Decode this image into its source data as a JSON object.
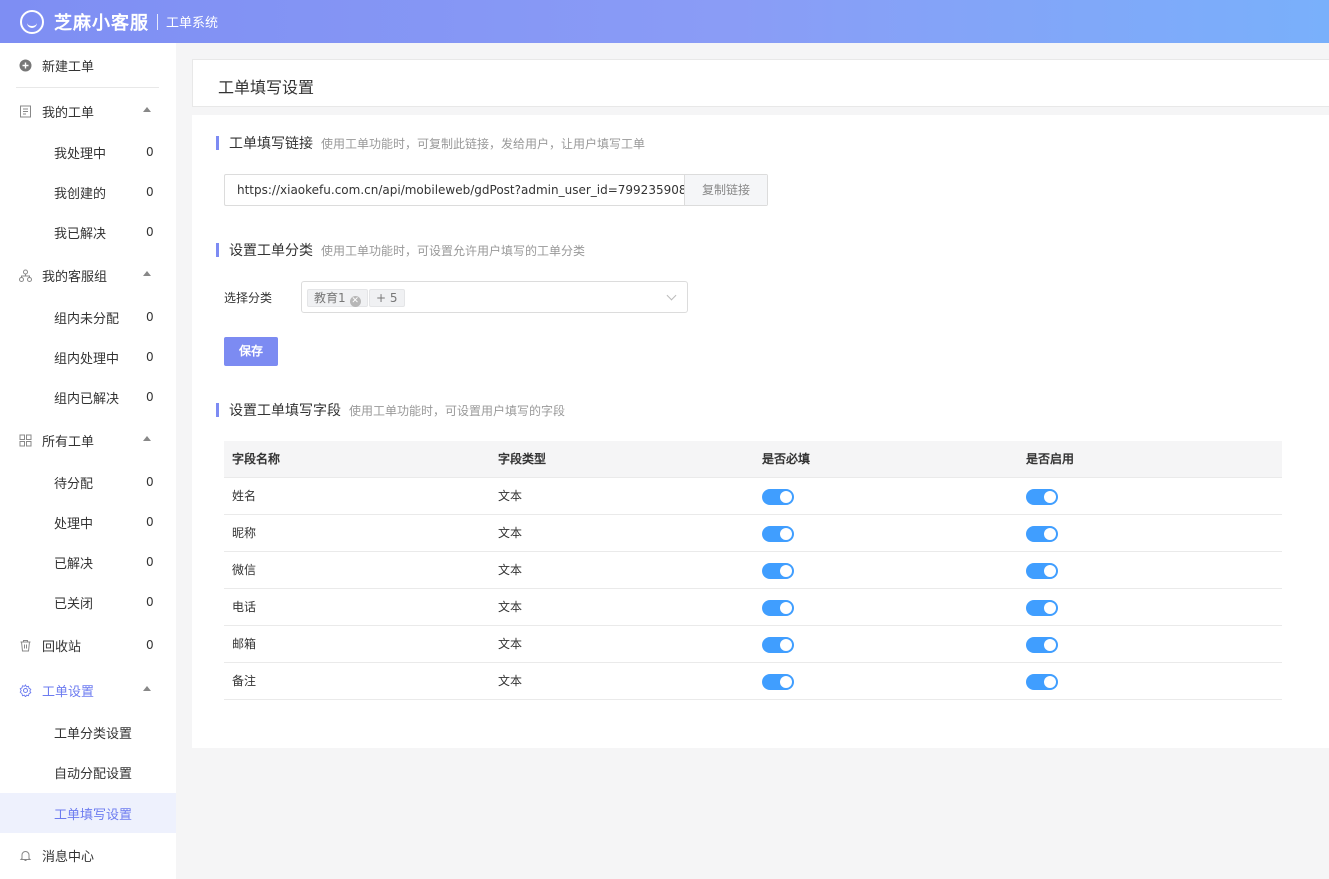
{
  "header": {
    "brand": "芝麻小客服",
    "subtitle": "工单系统"
  },
  "sidebar": {
    "new_ticket": "新建工单",
    "my_tickets": {
      "label": "我的工单",
      "items": [
        {
          "label": "我处理中",
          "count": "0"
        },
        {
          "label": "我创建的",
          "count": "0"
        },
        {
          "label": "我已解决",
          "count": "0"
        }
      ]
    },
    "my_group": {
      "label": "我的客服组",
      "items": [
        {
          "label": "组内未分配",
          "count": "0"
        },
        {
          "label": "组内处理中",
          "count": "0"
        },
        {
          "label": "组内已解决",
          "count": "0"
        }
      ]
    },
    "all_tickets": {
      "label": "所有工单",
      "items": [
        {
          "label": "待分配",
          "count": "0"
        },
        {
          "label": "处理中",
          "count": "0"
        },
        {
          "label": "已解决",
          "count": "0"
        },
        {
          "label": "已关闭",
          "count": "0"
        }
      ]
    },
    "recycle": {
      "label": "回收站",
      "count": "0"
    },
    "settings": {
      "label": "工单设置",
      "items": [
        {
          "label": "工单分类设置"
        },
        {
          "label": "自动分配设置"
        },
        {
          "label": "工单填写设置"
        }
      ]
    },
    "messages": "消息中心"
  },
  "page": {
    "title": "工单填写设置"
  },
  "link_section": {
    "title": "工单填写链接",
    "desc": "使用工单功能时，可复制此链接，发给用户，让用户填写工单",
    "url": "https://xiaokefu.com.cn/api/mobileweb/gdPost?admin_user_id=799235908",
    "copy_button": "复制链接"
  },
  "category_section": {
    "title": "设置工单分类",
    "desc": "使用工单功能时，可设置允许用户填写的工单分类",
    "select_label": "选择分类",
    "tag": "教育1",
    "more_tag": "+ 5",
    "save_button": "保存"
  },
  "fields_section": {
    "title": "设置工单填写字段",
    "desc": "使用工单功能时，可设置用户填写的字段",
    "columns": [
      "字段名称",
      "字段类型",
      "是否必填",
      "是否启用"
    ],
    "rows": [
      {
        "name": "姓名",
        "type": "文本",
        "required": true,
        "enabled": true
      },
      {
        "name": "昵称",
        "type": "文本",
        "required": true,
        "enabled": true
      },
      {
        "name": "微信",
        "type": "文本",
        "required": true,
        "enabled": true
      },
      {
        "name": "电话",
        "type": "文本",
        "required": true,
        "enabled": true
      },
      {
        "name": "邮箱",
        "type": "文本",
        "required": true,
        "enabled": true
      },
      {
        "name": "备注",
        "type": "文本",
        "required": true,
        "enabled": true
      }
    ]
  },
  "colors": {
    "accent": "#7c8bf2",
    "switch_on": "#409eff",
    "active_text": "#6d7cf0"
  }
}
